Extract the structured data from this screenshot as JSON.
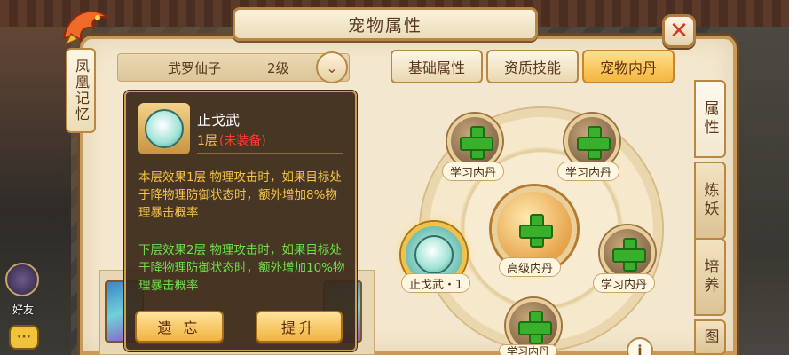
{
  "window": {
    "title": "宠物属性",
    "close_symbol": "✕",
    "side_memory_label": "凤凰记忆"
  },
  "pet": {
    "name": "武罗仙子",
    "level": "2级",
    "dropdown_symbol": "⌄"
  },
  "tabs": [
    {
      "label": "基础属性",
      "active": false
    },
    {
      "label": "资质技能",
      "active": false
    },
    {
      "label": "宠物内丹",
      "active": true
    }
  ],
  "side_tabs": [
    {
      "label": "属性",
      "active": true
    },
    {
      "label": "炼妖",
      "active": false
    },
    {
      "label": "培养",
      "active": false
    },
    {
      "label": "图",
      "active": false
    }
  ],
  "dan_board": {
    "center_label": "高级内丹",
    "slots": [
      "学习内丹",
      "学习内丹",
      "学习内丹",
      "学习内丹"
    ],
    "equipped_label": "止戈武・1",
    "info_symbol": "i"
  },
  "tooltip": {
    "skill_name": "止戈武",
    "level": "1层",
    "status": "(未装备)",
    "current_effect": "本层效果1层  物理攻击时，如果目标处于降物理防御状态时，额外增加8%物理暴击概率",
    "next_effect": "下层效果2层  物理攻击时，如果目标处于降物理防御状态时，额外增加10%物理暴击概率",
    "forget_button": "遗  忘",
    "upgrade_button": "提升"
  },
  "left_hud": {
    "friends_label": "好友",
    "chat_symbol": "···"
  },
  "colors": {
    "accent": "#f4b640",
    "panel_bg": "#f3e8cf",
    "current_effect_text": "#f3c447",
    "next_effect_text": "#6fe04a",
    "status_red": "#ff3b2f"
  }
}
